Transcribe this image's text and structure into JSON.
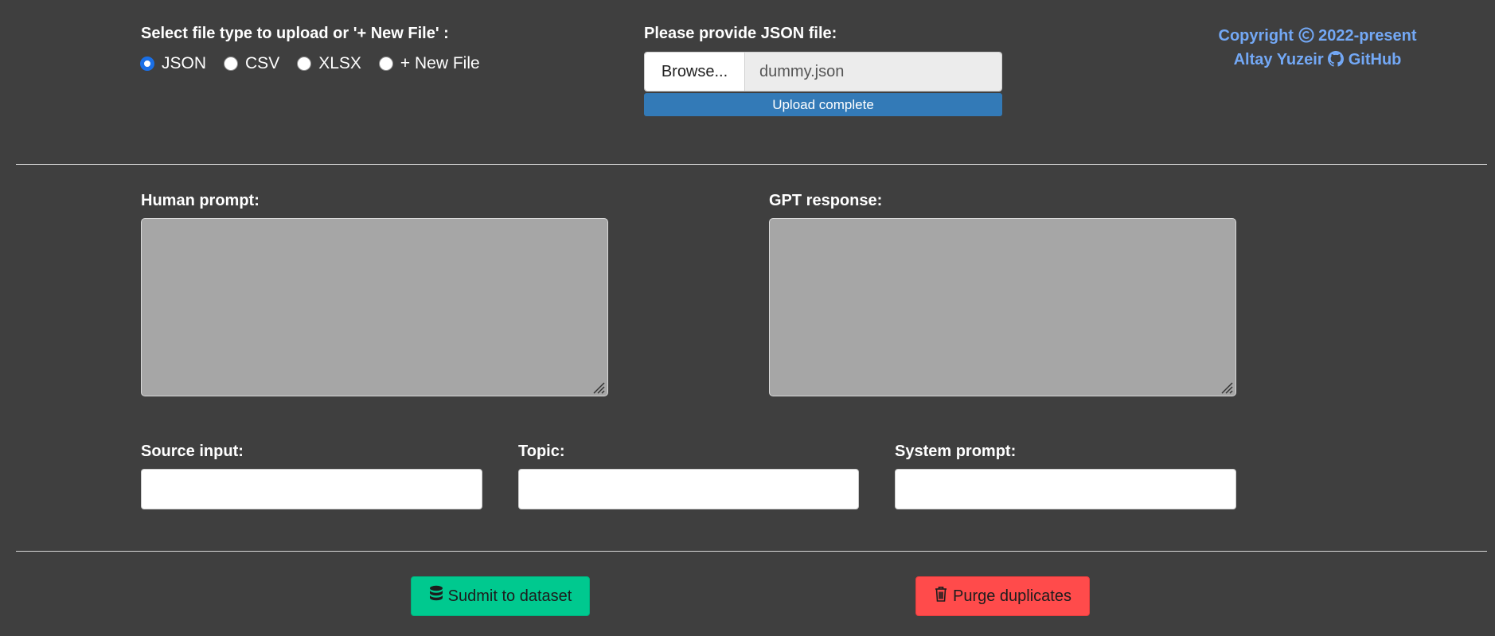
{
  "upload": {
    "select_label": "Select file type to upload or '+ New File' :",
    "options": [
      "JSON",
      "CSV",
      "XLSX",
      "+ New File"
    ],
    "selected": "JSON",
    "file_label": "Please provide JSON file:",
    "browse_label": "Browse...",
    "file_name": "dummy.json",
    "progress_text": "Upload complete",
    "progress_value": 1.0
  },
  "copyright": {
    "line1_prefix": "Copyright",
    "line1_suffix": "2022-present",
    "author": "Altay Yuzeir",
    "github_label": "GitHub"
  },
  "form": {
    "human_label": "Human prompt:",
    "human_value": "",
    "gpt_label": "GPT response:",
    "gpt_value": "",
    "source_label": "Source input:",
    "source_value": "",
    "topic_label": "Topic:",
    "topic_value": "",
    "system_label": "System prompt:",
    "system_value": ""
  },
  "actions": {
    "submit_label": "Sudmit to dataset",
    "purge_label": "Purge duplicates"
  },
  "colors": {
    "background": "#3f3f3f",
    "accent_link": "#73a8f5",
    "progress": "#337ab7",
    "submit": "#00c98f",
    "purge": "#ff4b4b"
  },
  "icons": [
    "copyright-icon",
    "github-icon",
    "database-icon",
    "trash-icon"
  ]
}
